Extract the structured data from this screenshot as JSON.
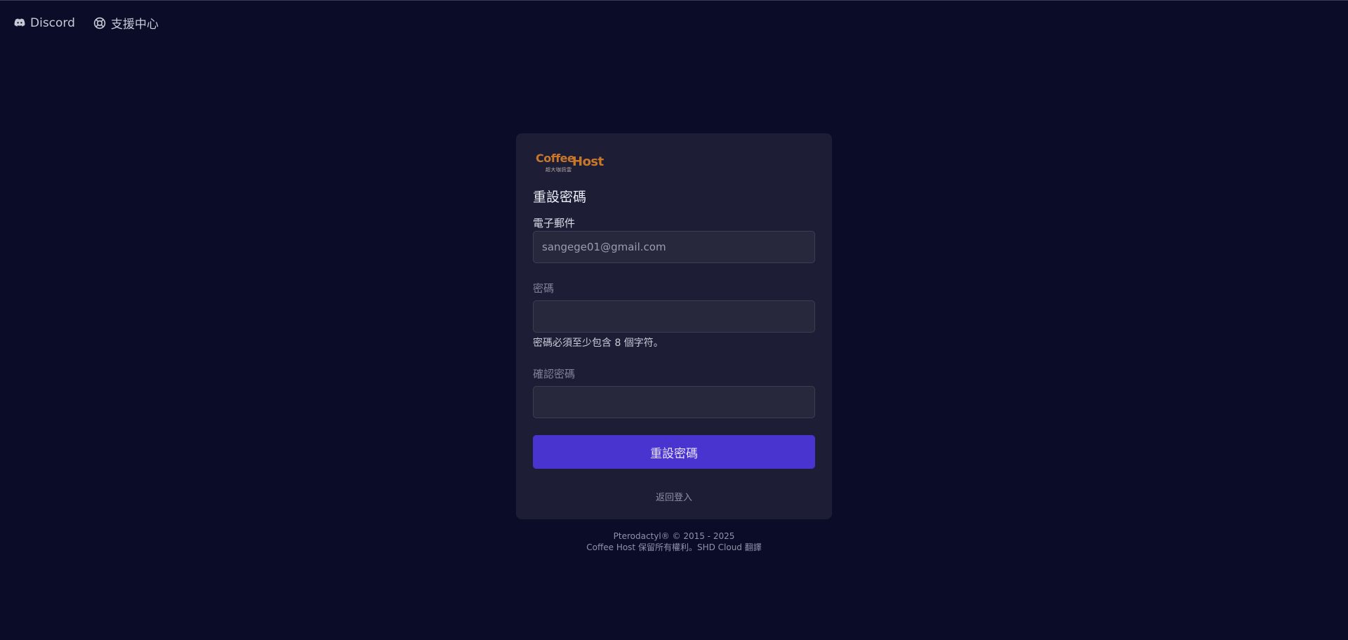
{
  "topnav": {
    "discord_label": "Discord",
    "support_label": "支援中心"
  },
  "logo": {
    "word1": "Coffee",
    "word2": "Host",
    "subtitle": "超大咖訊雲"
  },
  "form": {
    "title": "重設密碼",
    "email_label": "電子郵件",
    "email_value": "sangege01@gmail.com",
    "password_label": "密碼",
    "password_hint": "密碼必須至少包含 8 個字符。",
    "confirm_label": "確認密碼",
    "submit_label": "重設密碼",
    "back_link": "返回登入"
  },
  "footer": {
    "line1": "Pterodactyl® © 2015 - 2025",
    "line2": "Coffee Host 保留所有權利。SHD Cloud 翻譯"
  },
  "colors": {
    "background": "#0b0d28",
    "card": "#1d1e35",
    "accent": "#4a34cf",
    "brand": "#c8772a"
  }
}
